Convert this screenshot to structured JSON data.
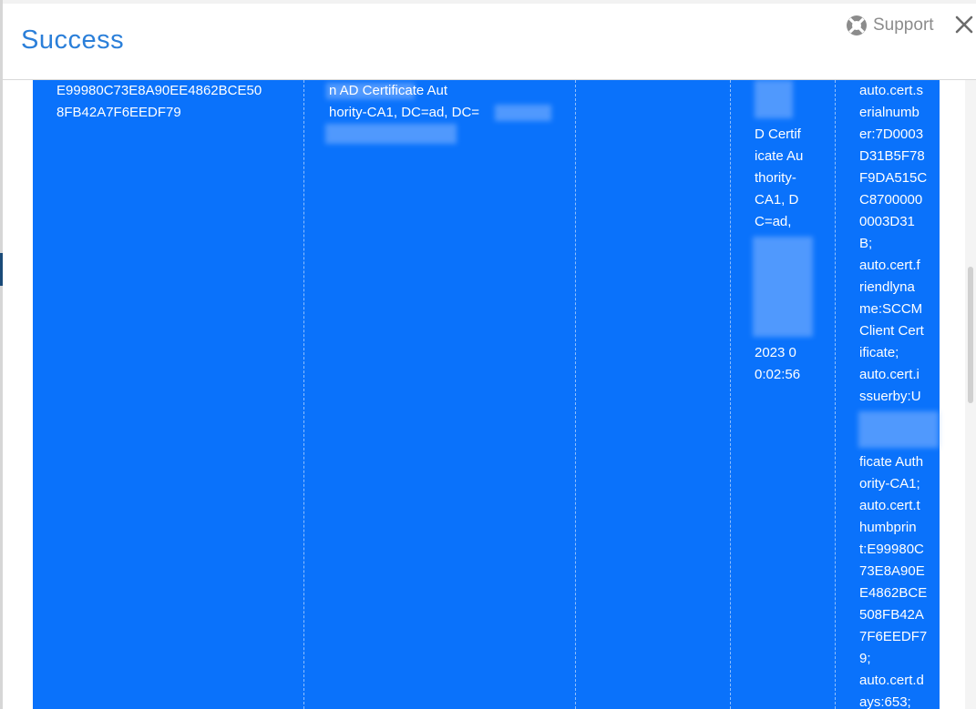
{
  "dialog": {
    "title": "Success",
    "support_label": "Support",
    "close_label": "Close",
    "icons": {
      "support": "lifebuoy-icon",
      "close": "close-icon"
    },
    "colors": {
      "title": "#2b7fd9",
      "selection": "#0a72fb",
      "text": "#ffffff",
      "support": "#8c8c8c"
    }
  },
  "table": {
    "thumbprint_cell": "E99980C73E8A90EE4862BCE50\n8FB42A7F6EEDF79",
    "issuer_cell": "n AD Certificate Aut\nhority-CA1, DC=ad, DC=",
    "issuer_detail_top": "D Certif\nicate Au\nthority-\nCA1, D\nC=ad,",
    "issuer_detail_bottom": "2023 0\n0:02:56",
    "attributes_top": "auto.cert.s\nerialnumb\ner:7D0003\nD31B5F78\nF9DA515C\nC8700000\n0003D31\nB;\nauto.cert.f\nriendlyna\nme:SCCM\nClient Cert\nificate;\nauto.cert.i\nssuerby:U",
    "attributes_bottom": "ficate Auth\nority-CA1;\nauto.cert.t\nhumbprin\nt:E99980C\n73E8A90E\nE4862BCE\n508FB42A\n7F6EEDF7\n9;\nauto.cert.d\nays:653;"
  }
}
